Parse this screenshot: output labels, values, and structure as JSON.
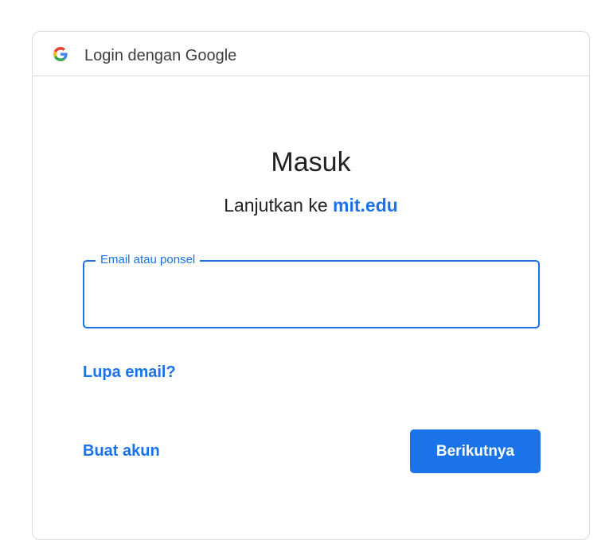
{
  "header": {
    "logo_icon": "google-g-icon",
    "title": "Login dengan Google"
  },
  "main": {
    "title": "Masuk",
    "subtitle_prefix": "Lanjutkan ke",
    "subtitle_domain": "mit.edu"
  },
  "email_field": {
    "label": "Email atau ponsel",
    "value": ""
  },
  "links": {
    "forgot_email": "Lupa email?",
    "create_account": "Buat akun"
  },
  "next_button": {
    "label": "Berikutnya"
  },
  "colors": {
    "accent": "#1a73e8",
    "text": "#202124",
    "border": "#dadce0"
  }
}
